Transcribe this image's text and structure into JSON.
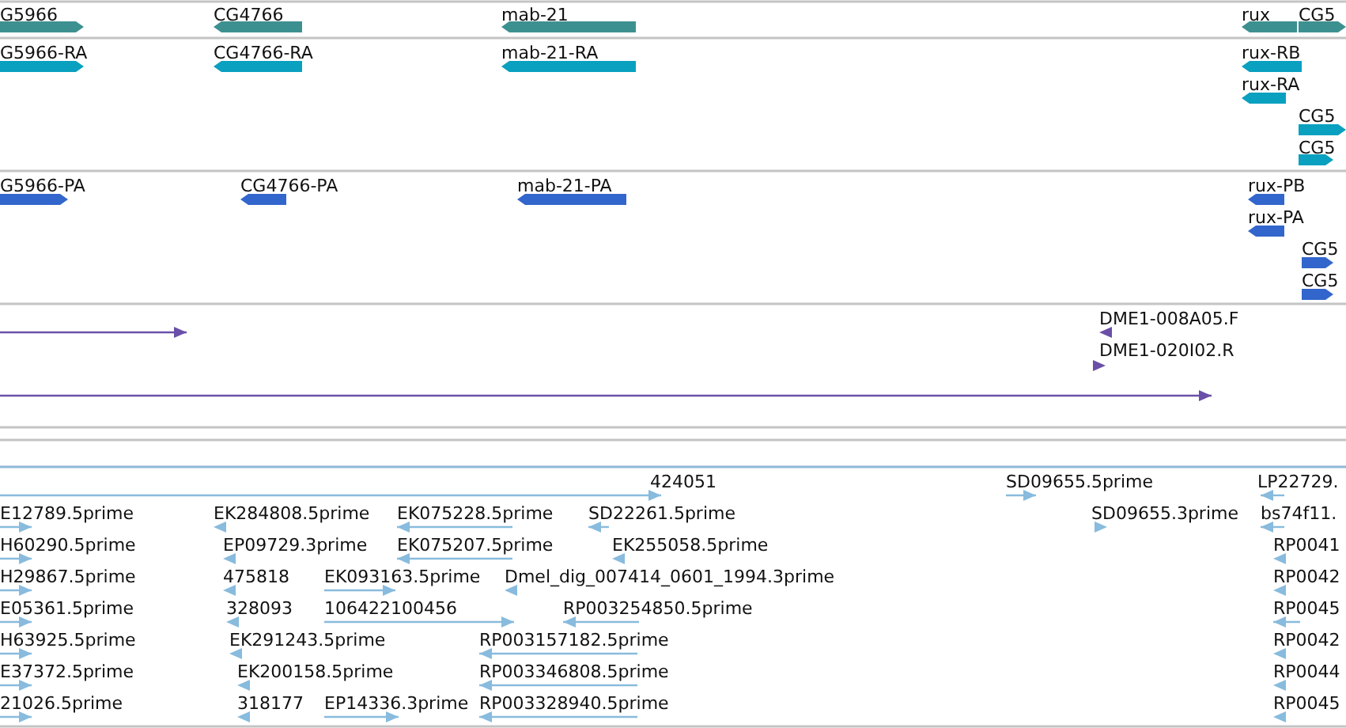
{
  "tracks": [
    {
      "kind": "gene",
      "color": "#3d9090",
      "features": [
        {
          "label": "G5966",
          "reverse": false
        },
        {
          "label": "CG4766",
          "reverse": true
        },
        {
          "label": "mab-21",
          "reverse": true
        },
        {
          "label": "rux",
          "reverse": true
        },
        {
          "label": "CG5",
          "reverse": false
        }
      ]
    },
    {
      "kind": "transcript",
      "color": "#0aa0c0",
      "features": [
        {
          "label": "G5966-RA",
          "reverse": false
        },
        {
          "label": "CG4766-RA",
          "reverse": true
        },
        {
          "label": "mab-21-RA",
          "reverse": true
        },
        {
          "label": "rux-RB",
          "reverse": true
        },
        {
          "label": "rux-RA",
          "reverse": true
        },
        {
          "label": "CG5",
          "reverse": false
        },
        {
          "label": "CG5",
          "reverse": false
        }
      ]
    },
    {
      "kind": "protein",
      "color": "#3366cc",
      "features": [
        {
          "label": "G5966-PA",
          "reverse": false
        },
        {
          "label": "CG4766-PA",
          "reverse": true
        },
        {
          "label": "mab-21-PA",
          "reverse": true
        },
        {
          "label": "rux-PB",
          "reverse": true
        },
        {
          "label": "rux-PA",
          "reverse": true
        },
        {
          "label": "CG5",
          "reverse": false
        },
        {
          "label": "CG5",
          "reverse": false
        }
      ]
    },
    {
      "kind": "clone",
      "color": "#6a4fa8",
      "features": [
        {
          "reverse": false
        },
        {
          "label": "DME1-008A05.F",
          "reverse": true
        },
        {
          "label": "DME1-020I02.R",
          "reverse": false
        },
        {
          "reverse": false
        }
      ]
    },
    {
      "kind": "est",
      "color": "#88bbdd",
      "features": [
        {
          "label": "424051",
          "reverse": false
        },
        {
          "label": "SD09655.5prime",
          "reverse": false
        },
        {
          "label": "LP22729.",
          "reverse": true
        },
        {
          "label": "E12789.5prime",
          "reverse": false
        },
        {
          "label": "EK284808.5prime",
          "reverse": true
        },
        {
          "label": "EK075228.5prime",
          "reverse": true
        },
        {
          "label": "SD22261.5prime",
          "reverse": true
        },
        {
          "label": "SD09655.3prime",
          "reverse": false
        },
        {
          "label": "bs74f11.",
          "reverse": true
        },
        {
          "label": "H60290.5prime",
          "reverse": false
        },
        {
          "label": "EP09729.3prime",
          "reverse": true
        },
        {
          "label": "EK075207.5prime",
          "reverse": true
        },
        {
          "label": "EK255058.5prime",
          "reverse": true
        },
        {
          "label": "RP0041",
          "reverse": true
        },
        {
          "label": "H29867.5prime",
          "reverse": false
        },
        {
          "label": "475818",
          "reverse": true
        },
        {
          "label": "EK093163.5prime",
          "reverse": false
        },
        {
          "label": "Dmel_dig_007414_0601_1994.3prime",
          "reverse": true
        },
        {
          "label": "RP0042",
          "reverse": true
        },
        {
          "label": "E05361.5prime",
          "reverse": false
        },
        {
          "label": "328093",
          "reverse": true
        },
        {
          "label": "106422100456",
          "reverse": false
        },
        {
          "label": "RP003254850.5prime",
          "reverse": true
        },
        {
          "label": "RP0045",
          "reverse": true
        },
        {
          "label": "H63925.5prime",
          "reverse": false
        },
        {
          "label": "EK291243.5prime",
          "reverse": true
        },
        {
          "label": "RP003157182.5prime",
          "reverse": true
        },
        {
          "label": "RP0042",
          "reverse": true
        },
        {
          "label": "E37372.5prime",
          "reverse": false
        },
        {
          "label": "EK200158.5prime",
          "reverse": true
        },
        {
          "label": "RP003346808.5prime",
          "reverse": true
        },
        {
          "label": "RP0044",
          "reverse": true
        },
        {
          "label": "21026.5prime",
          "reverse": false
        },
        {
          "label": "318177",
          "reverse": true
        },
        {
          "label": "EP14336.3prime",
          "reverse": false
        },
        {
          "label": "RP003328940.5prime",
          "reverse": true
        },
        {
          "label": "RP0045",
          "reverse": true
        }
      ]
    }
  ]
}
